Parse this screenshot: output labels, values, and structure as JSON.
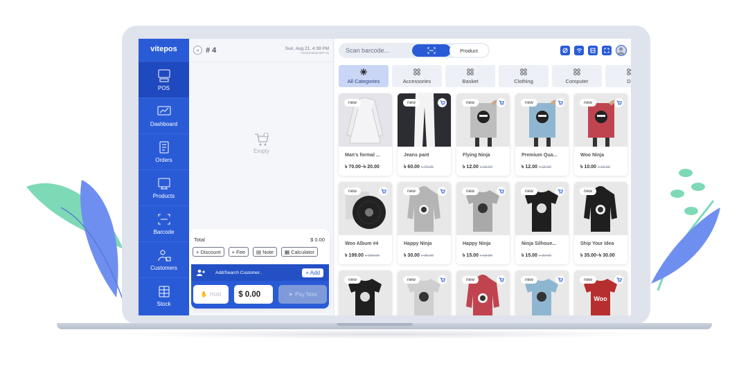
{
  "brand": "vitepos",
  "sidebar": {
    "items": [
      {
        "label": "POS",
        "icon": "pos-icon",
        "active": true
      },
      {
        "label": "Dashboard",
        "icon": "dashboard-icon",
        "active": false
      },
      {
        "label": "Orders",
        "icon": "orders-icon",
        "active": false
      },
      {
        "label": "Products",
        "icon": "products-icon",
        "active": false
      },
      {
        "label": "Barcode",
        "icon": "barcode-icon",
        "active": false
      },
      {
        "label": "Customers",
        "icon": "customers-icon",
        "active": false
      },
      {
        "label": "Stock",
        "icon": "stock-icon",
        "active": false
      }
    ]
  },
  "cart": {
    "collapse_icon": "«",
    "order_no": "# 4",
    "date": "Sun, Aug 21, 4:39 PM",
    "timezone": "Asia/Dhaka(GMT+6)",
    "empty_label": "Empty",
    "total_label": "Total",
    "total_value": "$ 0.00",
    "chips": [
      "+ Discount",
      "+ Fee",
      "Note",
      "Calculator"
    ],
    "customer_placeholder": "Add/Search Customer..",
    "add_label": "+ Add",
    "hold_label": "Hold",
    "amount": "$ 0.00",
    "pay_label": "Pay Now"
  },
  "search": {
    "placeholder": "Scan barcode...",
    "product_tab": "Product"
  },
  "categories": [
    {
      "label": "All Categories",
      "active": true
    },
    {
      "label": "Accessories",
      "active": false
    },
    {
      "label": "Basket",
      "active": false
    },
    {
      "label": "Clothing",
      "active": false
    },
    {
      "label": "Computer",
      "active": false
    },
    {
      "label": "De",
      "active": false
    }
  ],
  "badge_label": "new",
  "products": [
    {
      "name": "Man's formal ...",
      "price": "৳ 70.00–৳ 20.00",
      "old": "",
      "img": "shirt",
      "color": "#e9e9ee",
      "cart": false
    },
    {
      "name": "Jeans pant",
      "price": "৳ 60.00",
      "old": "৳ 70.00",
      "img": "pants",
      "color": "#2b2d33",
      "cart": true
    },
    {
      "name": "Flying Ninja",
      "price": "৳ 12.00",
      "old": "৳ 15.00",
      "img": "poster",
      "color": "#bdbdbd",
      "cart": true
    },
    {
      "name": "Premium Qua...",
      "price": "৳ 12.00",
      "old": "৳ 15.00",
      "img": "poster",
      "color": "#8fb6d1",
      "cart": true
    },
    {
      "name": "Woo Ninja",
      "price": "৳ 10.00",
      "old": "৳ 15.00",
      "img": "poster",
      "color": "#c0444f",
      "cart": true
    },
    {
      "name": "Woo Album #4",
      "price": "৳ 199.00",
      "old": "৳ 200.00",
      "img": "album",
      "color": "#333333",
      "cart": true
    },
    {
      "name": "Happy Ninja",
      "price": "৳ 30.00",
      "old": "৳ 35.00",
      "img": "hoodie",
      "color": "#b5b5b5",
      "cart": true
    },
    {
      "name": "Happy Ninja",
      "price": "৳ 15.00",
      "old": "৳ 18.00",
      "img": "tshirt",
      "color": "#a9a9a9",
      "cart": true
    },
    {
      "name": "Ninja Silhoue...",
      "price": "৳ 15.00",
      "old": "৳ 20.00",
      "img": "tshirt",
      "color": "#1f1f1f",
      "cart": true
    },
    {
      "name": "Ship Your Idea",
      "price": "৳ 35.00–৳ 30.00",
      "old": "",
      "img": "hoodie",
      "color": "#1f1f1f",
      "cart": false
    },
    {
      "name": "",
      "price": "",
      "old": "",
      "img": "tshirt",
      "color": "#1f1f1f",
      "cart": false
    },
    {
      "name": "",
      "price": "",
      "old": "",
      "img": "tshirt",
      "color": "#cfcfcf",
      "cart": true
    },
    {
      "name": "",
      "price": "",
      "old": "",
      "img": "hoodie",
      "color": "#c0444f",
      "cart": true
    },
    {
      "name": "",
      "price": "",
      "old": "",
      "img": "tshirt",
      "color": "#8fb6d1",
      "cart": true
    },
    {
      "name": "",
      "price": "",
      "old": "",
      "img": "tshirt",
      "color": "#b72e2e",
      "cart": true,
      "logo": "Woo"
    }
  ],
  "colors": {
    "accent": "#2a5bd7",
    "sidebar_active": "#1f49bf"
  }
}
